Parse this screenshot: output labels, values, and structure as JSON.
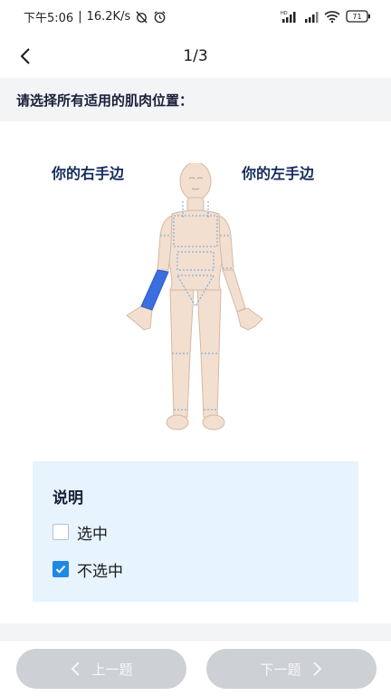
{
  "status_bar": {
    "time": "下午5:06",
    "network_speed": "16.2K/s",
    "signal_label": "HD",
    "battery_level": "71",
    "icons": [
      "alarm-off-icon",
      "alarm-clock-icon",
      "signal-icon",
      "wifi-icon",
      "battery-icon"
    ]
  },
  "header": {
    "back_icon": "chevron-left-icon",
    "page_counter": "1/3"
  },
  "instruction": "请选择所有适用的肌肉位置：",
  "body_map": {
    "right_side_label": "你的右手边",
    "left_side_label": "你的左手边",
    "selected_color": "#3b6fe0",
    "selected_regions": [
      "right-forearm"
    ]
  },
  "legend": {
    "title": "说明",
    "items": [
      {
        "label": "选中",
        "checked": false
      },
      {
        "label": "不选中",
        "checked": true
      }
    ]
  },
  "footer": {
    "prev_label": "上一题",
    "next_label": "下一题",
    "prev_icon": "chevron-left-icon",
    "next_icon": "chevron-right-icon"
  },
  "colors": {
    "accent": "#1e88e5",
    "legend_bg": "#e7f3fd",
    "disabled_button": "#cdd0d4"
  }
}
